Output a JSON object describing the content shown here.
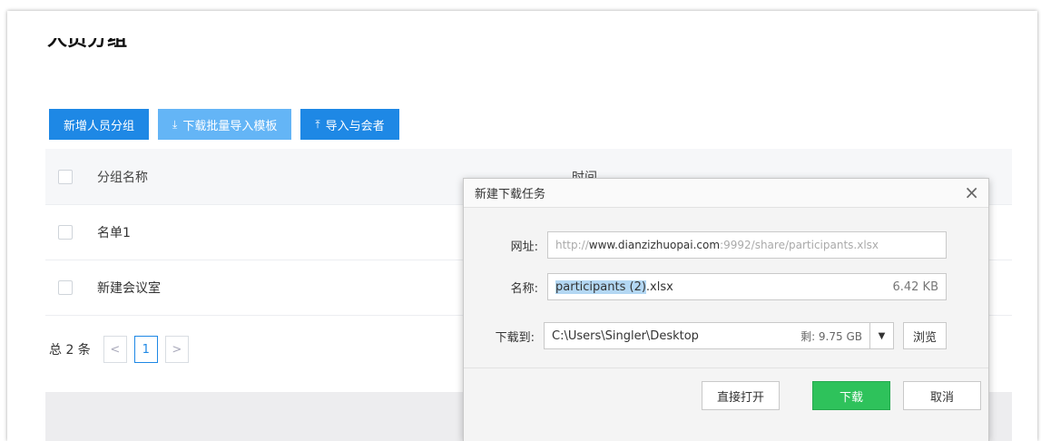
{
  "page": {
    "title": "人员分组"
  },
  "toolbar": {
    "add_group": "新增人员分组",
    "download_template": "下载批量导入模板",
    "import_participants": "导入与会者",
    "download_icon": "download-icon",
    "upload_icon": "upload-icon"
  },
  "table": {
    "headers": {
      "name": "分组名称",
      "time": "时间"
    },
    "rows": [
      {
        "name": "名单1"
      },
      {
        "name": "新建会议室"
      }
    ]
  },
  "pagination": {
    "total": "总 2 条",
    "prev": "<",
    "current": "1",
    "next": ">"
  },
  "dialog": {
    "title": "新建下载任务",
    "close": "×",
    "url_label": "网址:",
    "url_prefix": "http://",
    "url_domain": "www.dianzizhuopai.com",
    "url_rest": ":9992/share/participants.xlsx",
    "name_label": "名称:",
    "name_selected": "participants (2)",
    "name_ext": ".xlsx",
    "file_size": "6.42 KB",
    "path_label": "下载到:",
    "path_value": "C:\\Users\\Singler\\Desktop",
    "free_space": "剩: 9.75 GB",
    "dropdown": "▼",
    "browse": "浏览",
    "open_directly": "直接打开",
    "download": "下载",
    "cancel": "取消"
  },
  "colors": {
    "primary": "#1e88e5",
    "primary_light": "#64b5f6",
    "download_green": "#2ec25b"
  }
}
